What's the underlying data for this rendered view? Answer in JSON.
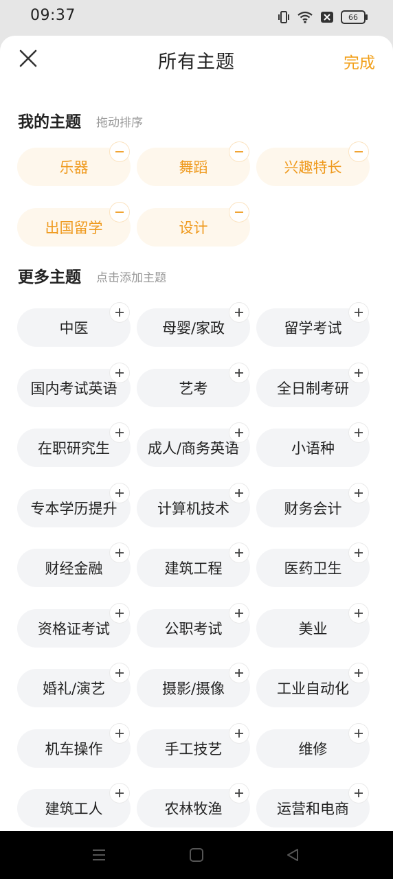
{
  "status_bar": {
    "time": "09:37",
    "battery_level": "66",
    "icons": [
      "vibrate-icon",
      "wifi-icon",
      "sim-off-icon",
      "battery-icon"
    ]
  },
  "header": {
    "title": "所有主题",
    "done_label": "完成",
    "close_icon": "close-icon"
  },
  "my_topics": {
    "title": "我的主题",
    "hint": "拖动排序",
    "badge_icon": "minus-icon",
    "items": [
      "乐器",
      "舞蹈",
      "兴趣特长",
      "出国留学",
      "设计"
    ]
  },
  "more_topics": {
    "title": "更多主题",
    "hint": "点击添加主题",
    "badge_icon": "plus-icon",
    "items": [
      "中医",
      "母婴/家政",
      "留学考试",
      "国内考试英语",
      "艺考",
      "全日制考研",
      "在职研究生",
      "成人/商务英语",
      "小语种",
      "专本学历提升",
      "计算机技术",
      "财务会计",
      "财经金融",
      "建筑工程",
      "医药卫生",
      "资格证考试",
      "公职考试",
      "美业",
      "婚礼/演艺",
      "摄影/摄像",
      "工业自动化",
      "机车操作",
      "手工技艺",
      "维修",
      "建筑工人",
      "农林牧渔",
      "运营和电商"
    ]
  },
  "nav_bar": {
    "icons": [
      "menu-icon",
      "home-icon",
      "back-icon"
    ]
  },
  "colors": {
    "accent": "#f2a01a",
    "mine_chip_bg": "#fef7ec",
    "more_chip_bg": "#f3f4f6"
  }
}
